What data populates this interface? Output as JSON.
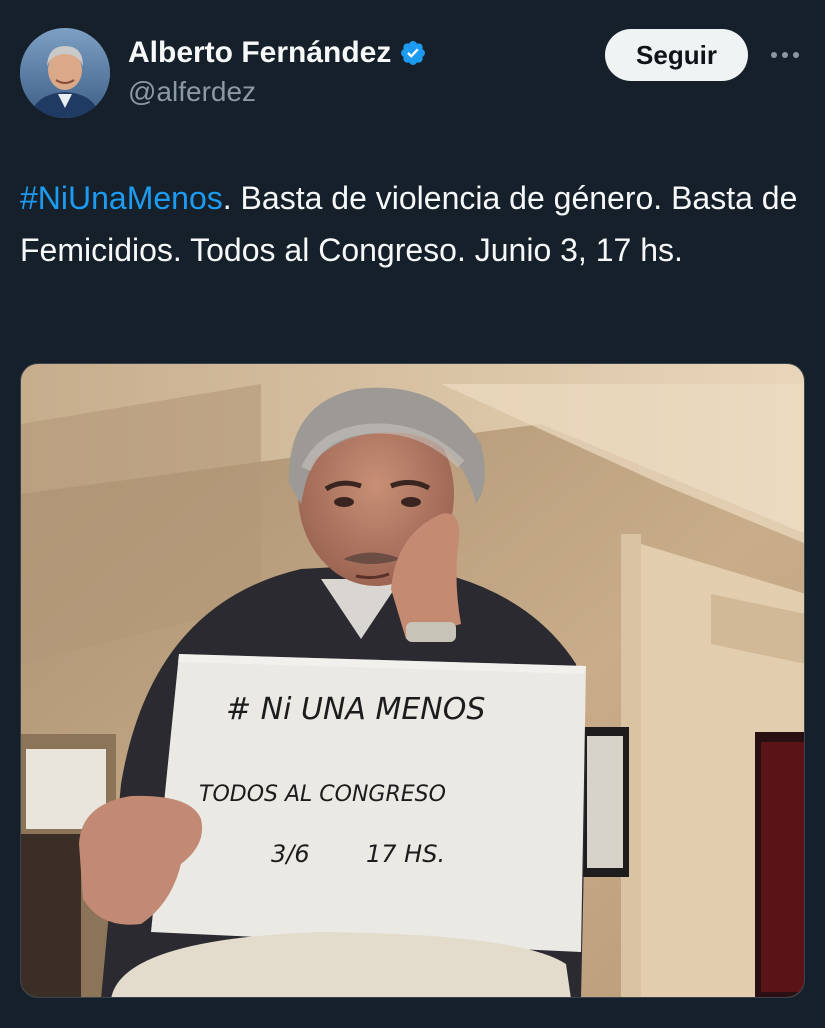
{
  "author": {
    "display_name": "Alberto Fernández",
    "handle": "@alferdez",
    "verified": true,
    "verified_icon": "verified-badge-icon"
  },
  "actions": {
    "follow_label": "Seguir",
    "more_icon": "more-options-icon"
  },
  "tweet": {
    "hashtag": "#NiUnaMenos",
    "text_rest": ". Basta de violencia de género. Basta de Femicidios. Todos al Congreso. Junio 3, 17 hs."
  },
  "media": {
    "sign": {
      "line1": "# Ni UNA MENOS",
      "line2": "TODOS AL CONGRESO",
      "line3_date": "3/6",
      "line3_time": "17 HS."
    }
  },
  "colors": {
    "background": "#15202b",
    "link": "#1d9bf0",
    "muted": "#8b98a5",
    "button_bg": "#eff3f4"
  }
}
